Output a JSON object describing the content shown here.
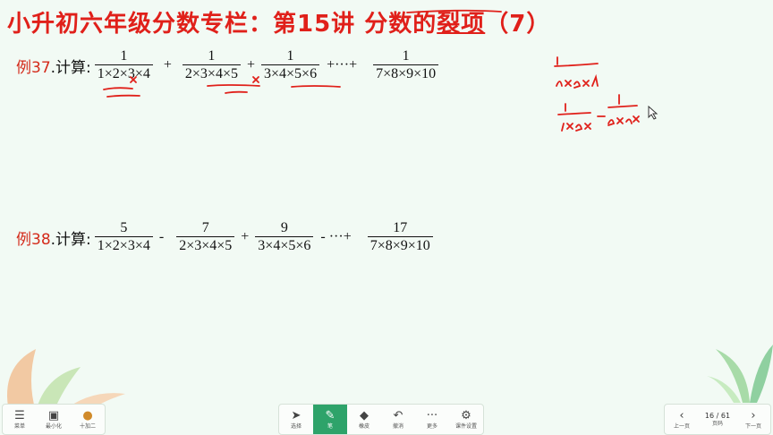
{
  "title": {
    "part1": "小升初六年级分数专栏：第15讲 分数的",
    "part2": "裂项",
    "part3": "（7）"
  },
  "examples": [
    {
      "label": "例37",
      "suffix": ".计算:",
      "terms": [
        {
          "num": "1",
          "den": "1×2×3×4",
          "op": "+"
        },
        {
          "num": "1",
          "den": "2×3×4×5",
          "op": "+"
        },
        {
          "num": "1",
          "den": "3×4×5×6",
          "op": "+···+"
        },
        {
          "num": "1",
          "den": "7×8×9×10",
          "op": ""
        }
      ]
    },
    {
      "label": "例38",
      "suffix": ".计算:",
      "terms": [
        {
          "num": "5",
          "den": "1×2×3×4",
          "op": "-"
        },
        {
          "num": "7",
          "den": "2×3×4×5",
          "op": "+"
        },
        {
          "num": "9",
          "den": "3×4×5×6",
          "op": "- ···+"
        },
        {
          "num": "17",
          "den": "7×8×9×10",
          "op": ""
        }
      ]
    }
  ],
  "toolbar": {
    "left": [
      {
        "icon": "menu-icon",
        "label": "菜单"
      },
      {
        "icon": "minimize-icon",
        "label": "最小化"
      },
      {
        "icon": "avatar-icon",
        "label": "十加二"
      }
    ],
    "center": [
      {
        "icon": "select-icon",
        "label": "选择"
      },
      {
        "icon": "pen-icon",
        "label": "笔"
      },
      {
        "icon": "eraser-icon",
        "label": "橡皮"
      },
      {
        "icon": "undo-icon",
        "label": "撤消"
      },
      {
        "icon": "more-icon",
        "label": "更多"
      },
      {
        "icon": "gear-icon",
        "label": "课件设置"
      }
    ],
    "right": {
      "prev": "上一页",
      "page": "16 / 61",
      "page_label": "页码",
      "next": "下一页"
    }
  },
  "colors": {
    "accent": "#e0201a",
    "pen": "#e0201a",
    "active": "#2ea36a"
  }
}
